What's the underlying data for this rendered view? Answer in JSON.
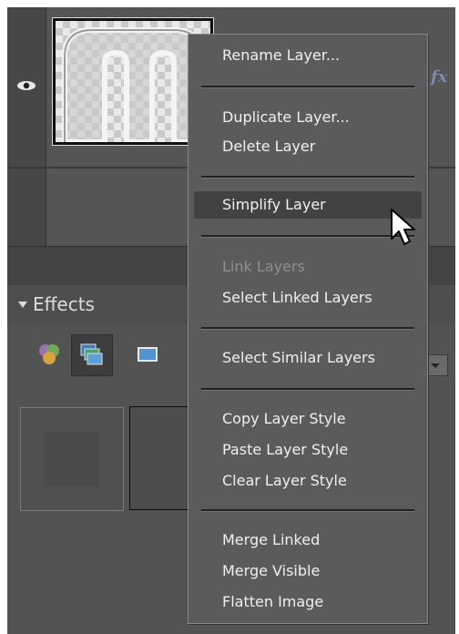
{
  "layers_panel": {
    "fx_badge": "fx"
  },
  "effects_panel": {
    "title": "Effects"
  },
  "context_menu": {
    "items": [
      {
        "label": "Rename Layer...",
        "enabled": true
      },
      {
        "label": "Duplicate Layer...",
        "enabled": true
      },
      {
        "label": "Delete Layer",
        "enabled": true
      },
      {
        "label": "Simplify Layer",
        "enabled": true,
        "highlighted": true
      },
      {
        "label": "Link Layers",
        "enabled": false
      },
      {
        "label": "Select Linked Layers",
        "enabled": true
      },
      {
        "label": "Select Similar Layers",
        "enabled": true
      },
      {
        "label": "Copy Layer Style",
        "enabled": true
      },
      {
        "label": "Paste Layer Style",
        "enabled": true
      },
      {
        "label": "Clear Layer Style",
        "enabled": true
      },
      {
        "label": "Merge Linked",
        "enabled": true
      },
      {
        "label": "Merge Visible",
        "enabled": true
      },
      {
        "label": "Flatten Image",
        "enabled": true
      }
    ]
  },
  "icons": [
    "eye-icon",
    "layer-styles-icon",
    "filters-icon",
    "photo-effects-icon",
    "mouse-cursor-icon"
  ],
  "colors": {
    "panel_bg": "#535353",
    "menu_bg": "#5b5b5b",
    "menu_highlight": "#424242",
    "menu_text": "#f0f0f0",
    "menu_text_disabled": "#8f8f8f",
    "fx_badge": "#7a8bb4"
  }
}
